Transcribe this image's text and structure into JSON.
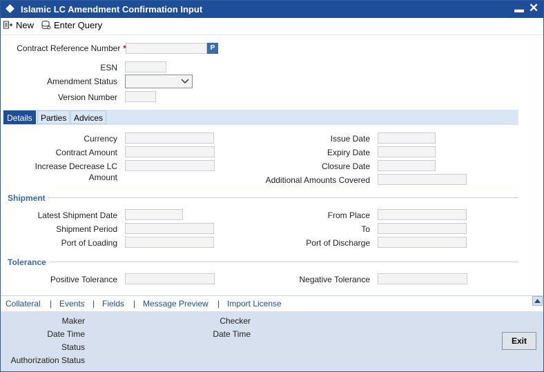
{
  "window": {
    "title": "Islamic LC Amendment Confirmation Input",
    "minimize": "▬",
    "close": "✕"
  },
  "toolbar": {
    "new_label": "New",
    "enter_query_label": "Enter Query"
  },
  "header_form": {
    "contract_ref_label": "Contract Reference Number",
    "required_mark": "*",
    "lov_button": "P",
    "esn_label": "ESN",
    "amendment_status_label": "Amendment Status",
    "version_number_label": "Version Number"
  },
  "tabs": [
    "Details",
    "Parties",
    "Advices"
  ],
  "details": {
    "currency_label": "Currency",
    "contract_amount_label": "Contract Amount",
    "increase_decrease_label_1": "Increase Decrease LC",
    "increase_decrease_label_2": "Amount",
    "issue_date_label": "Issue Date",
    "expiry_date_label": "Expiry Date",
    "closure_date_label": "Closure Date",
    "additional_amounts_label": "Additional Amounts Covered"
  },
  "shipment": {
    "section_title": "Shipment",
    "latest_shipment_date_label": "Latest Shipment Date",
    "shipment_period_label": "Shipment Period",
    "port_of_loading_label": "Port of Loading",
    "from_place_label": "From Place",
    "to_label": "To",
    "port_of_discharge_label": "Port of Discharge"
  },
  "tolerance": {
    "section_title": "Tolerance",
    "positive_label": "Positive Tolerance",
    "negative_label": "Negative Tolerance"
  },
  "links": [
    "Collateral",
    "Events",
    "Fields",
    "Message Preview",
    "Import License"
  ],
  "link_separator": "|",
  "footer": {
    "maker_label": "Maker",
    "date_time_label": "Date Time",
    "status_label": "Status",
    "authorization_status_label": "Authorization Status",
    "checker_label": "Checker",
    "checker_date_time_label": "Date Time",
    "exit_label": "Exit"
  },
  "colors": {
    "title_bar": "#1f4e98",
    "section_text": "#3c6aa6",
    "footer_bg": "#d6e0ee",
    "tab_active": "#1f4e98"
  }
}
